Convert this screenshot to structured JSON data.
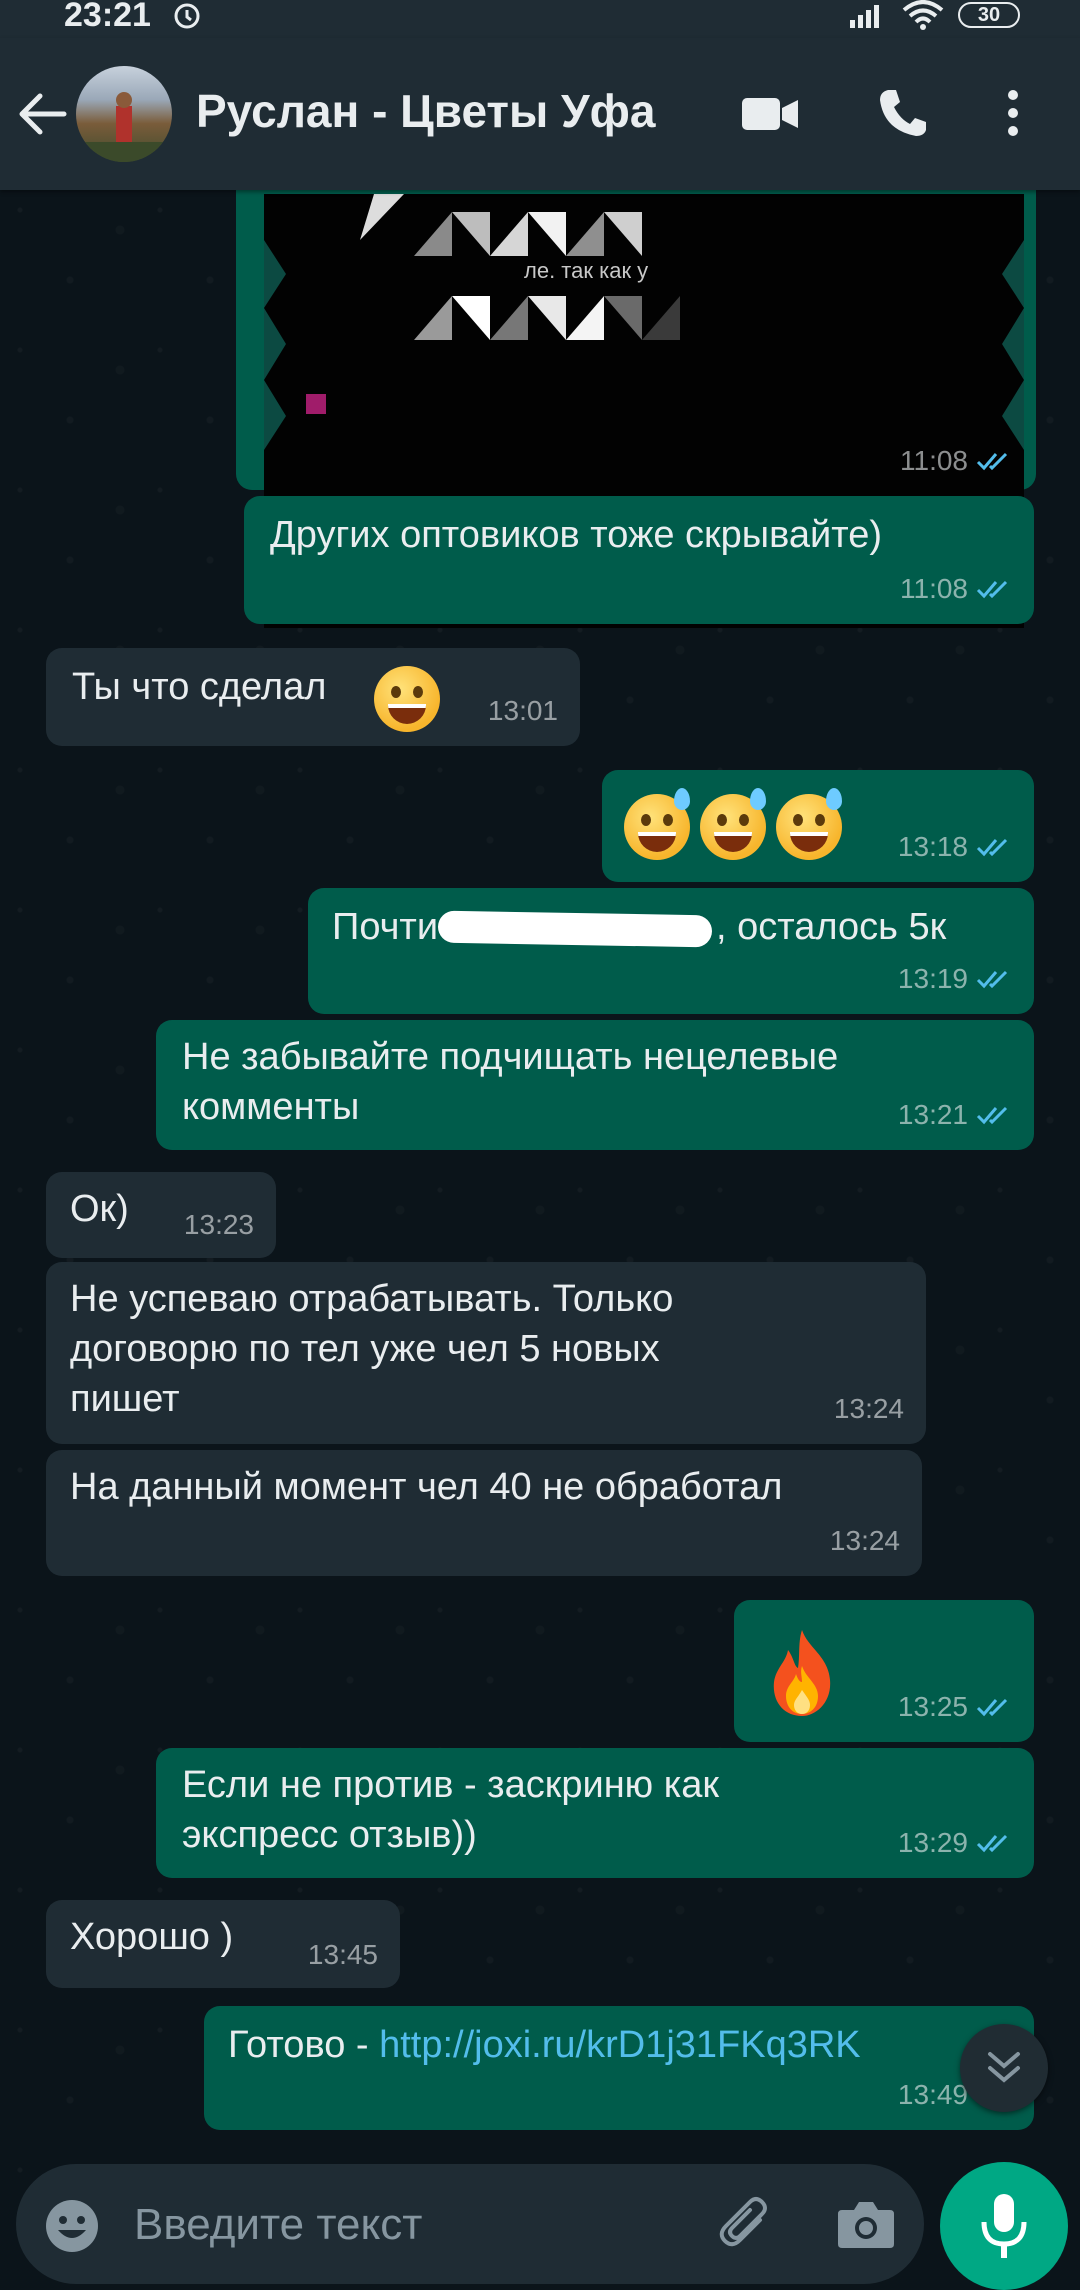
{
  "status_bar": {
    "time": "23:21",
    "battery": "30"
  },
  "header": {
    "contact_name": "Руслан - Цветы Уфа"
  },
  "messages": [
    {
      "id": "m0",
      "direction": "out",
      "text": "",
      "time": "11:08"
    },
    {
      "id": "m1",
      "direction": "out",
      "text": "Других оптовиков тоже скрывайте)",
      "time": "11:08"
    },
    {
      "id": "m2",
      "direction": "in",
      "text": "Ты что сделал",
      "time": "13:01"
    },
    {
      "id": "m3",
      "direction": "out",
      "text": "",
      "time": "13:18"
    },
    {
      "id": "m4",
      "direction": "out",
      "text_before": "Почти",
      "text_after": ", осталось 5к",
      "time": "13:19"
    },
    {
      "id": "m5",
      "direction": "out",
      "line1": "Не забывайте подчищать нецелевые",
      "line2": "комменты",
      "time": "13:21"
    },
    {
      "id": "m6",
      "direction": "in",
      "text": "Ок)",
      "time": "13:23"
    },
    {
      "id": "m7",
      "direction": "in",
      "line1": "Не успеваю отрабатывать. Только",
      "line2": "договорю по тел уже чел 5 новых",
      "line3": "пишет",
      "time": "13:24"
    },
    {
      "id": "m8",
      "direction": "in",
      "text": "На данный момент чел 40 не обработал",
      "time": "13:24"
    },
    {
      "id": "m9",
      "direction": "out",
      "text": "",
      "time": "13:25"
    },
    {
      "id": "m10",
      "direction": "out",
      "line1": "Если не против - заскриню как",
      "line2": "экспресс отзыв))",
      "time": "13:29"
    },
    {
      "id": "m11",
      "direction": "in",
      "text": "Хорошо )",
      "time": "13:45"
    },
    {
      "id": "m12",
      "direction": "out",
      "text_before": "Готово - ",
      "link": "http://joxi.ru/krD1j31FKq3RK",
      "time": "13:49"
    }
  ],
  "screenshot_text": "ле. так как у",
  "composer": {
    "placeholder": "Введите текст"
  },
  "colors": {
    "outgoing_bubble": "#005c4b",
    "incoming_bubble": "#1f2c34",
    "accent": "#00a884",
    "link": "#53bdeb",
    "read_ticks": "#53bdeb"
  }
}
